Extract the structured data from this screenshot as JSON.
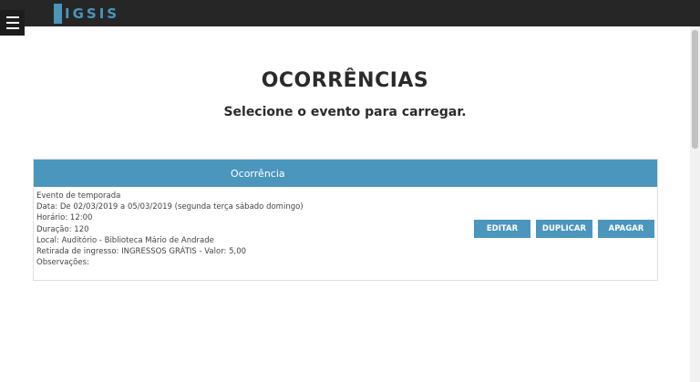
{
  "header": {
    "logo_text": "IGSIS"
  },
  "main": {
    "title": "OCORRÊNCIAS",
    "subtitle": "Selecione o evento para carregar."
  },
  "occurrence_panel": {
    "header_label": "Ocorrência",
    "details": [
      "Evento de temporada",
      "Data: De 02/03/2019 a 05/03/2019 (segunda terça sábado domingo)",
      "Horário: 12:00",
      "Duração: 120",
      "Local: Auditório - Biblioteca Mário de Andrade",
      "Retirada de ingresso: INGRESSOS GRÁTIS - Valor: 5,00",
      "Observações:"
    ],
    "buttons": {
      "edit": "EDITAR",
      "duplicate": "DUPLICAR",
      "delete": "APAGAR"
    }
  },
  "colors": {
    "topbar": "#262626",
    "accent": "#4b96bd"
  },
  "icons": {
    "menu": "hamburger-menu-icon"
  }
}
